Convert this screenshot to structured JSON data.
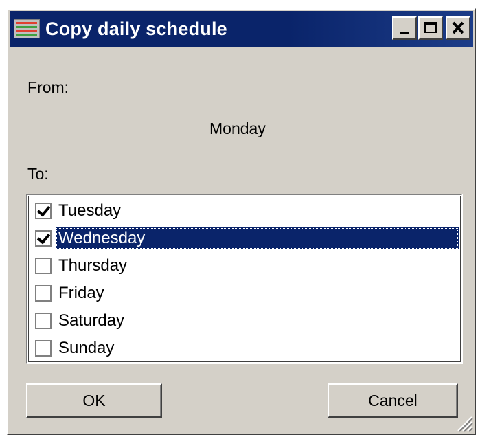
{
  "window": {
    "title": "Copy daily schedule",
    "icon": "schedule-app-icon",
    "controls": [
      "minimize",
      "maximize",
      "close"
    ]
  },
  "from": {
    "label": "From:",
    "value": "Monday"
  },
  "to": {
    "label": "To:",
    "items": [
      {
        "label": "Tuesday",
        "checked": true,
        "selected": false
      },
      {
        "label": "Wednesday",
        "checked": true,
        "selected": true
      },
      {
        "label": "Thursday",
        "checked": false,
        "selected": false
      },
      {
        "label": "Friday",
        "checked": false,
        "selected": false
      },
      {
        "label": "Saturday",
        "checked": false,
        "selected": false
      },
      {
        "label": "Sunday",
        "checked": false,
        "selected": false
      }
    ]
  },
  "buttons": {
    "ok_label": "OK",
    "cancel_label": "Cancel"
  },
  "colors": {
    "title_bar": "#0a246a",
    "face": "#d4d0c8",
    "selection": "#0a246a"
  }
}
